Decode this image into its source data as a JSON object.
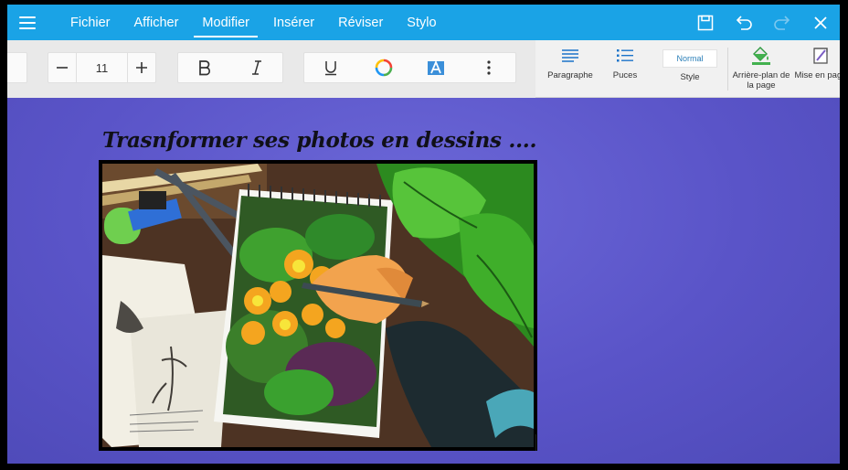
{
  "appbar": {
    "menu": [
      "Fichier",
      "Afficher",
      "Modifier",
      "Insérer",
      "Réviser",
      "Stylo"
    ],
    "active_index": 2,
    "accent_color": "#1aa3e6"
  },
  "ribbon": {
    "font_size": "11",
    "paragraph_label": "Paragraphe",
    "bullets_label": "Puces",
    "style_value": "Normal",
    "style_label": "Style",
    "background_label": "Arrière-plan de la page",
    "layout_label": "Mise en page"
  },
  "document": {
    "title": "Trasnformer ses photos en dessins ....",
    "background_color": "#5b53c6"
  }
}
